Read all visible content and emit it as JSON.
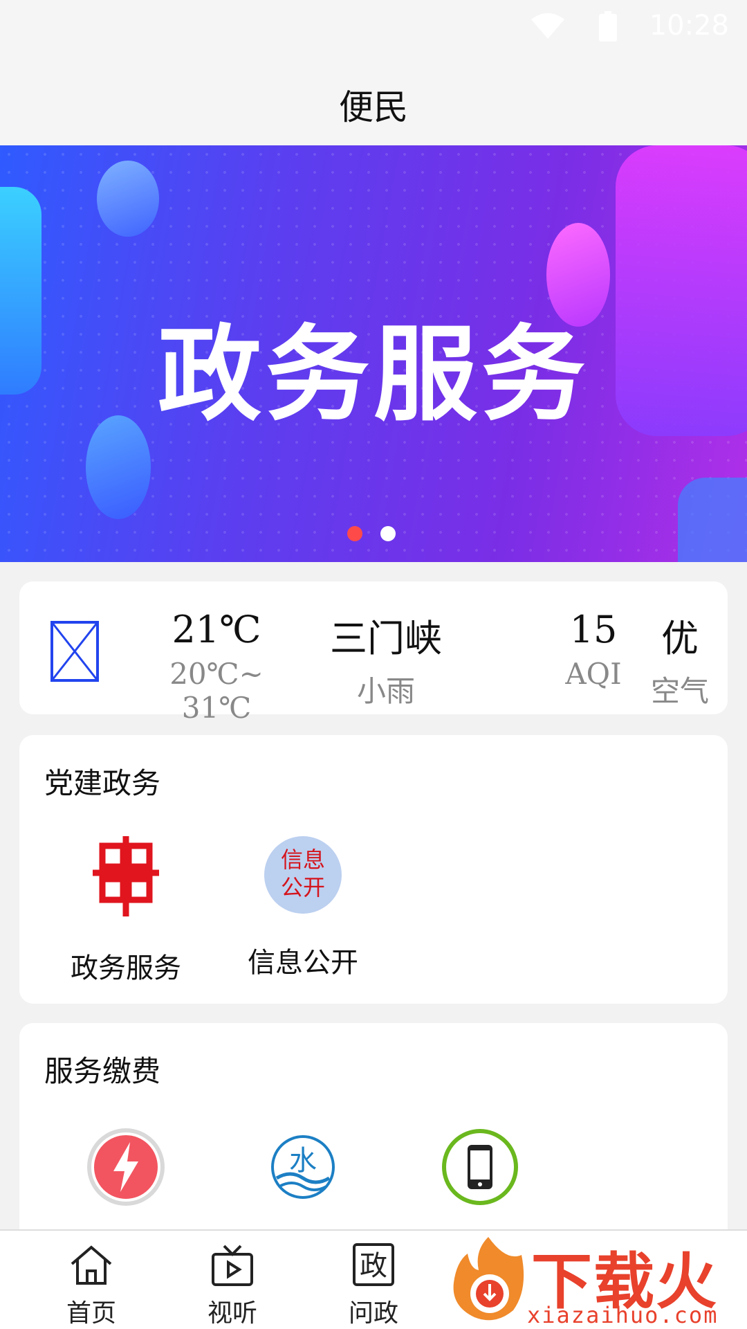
{
  "status_bar": {
    "time": "10:28"
  },
  "header": {
    "title": "便民"
  },
  "banner": {
    "headline": "政务服务",
    "slides": 2,
    "active_slide": 1
  },
  "weather": {
    "temperature": "21℃",
    "range": "20℃~ 31℃",
    "city": "三门峡",
    "condition": "小雨",
    "aqi_value": "15",
    "aqi_label": "AQI",
    "air_quality": "优",
    "air_label": "空气"
  },
  "sections": [
    {
      "title": "党建政务",
      "items": [
        {
          "label": "政务服务",
          "icon": "government-service-icon"
        },
        {
          "label": "信息公开",
          "icon": "info-disclosure-icon",
          "icon_text_top": "信息",
          "icon_text_bottom": "公开"
        }
      ]
    },
    {
      "title": "服务缴费",
      "items": [
        {
          "label": "",
          "icon": "electricity-icon"
        },
        {
          "label": "",
          "icon": "water-icon",
          "icon_text": "水"
        },
        {
          "label": "",
          "icon": "mobile-phone-icon"
        }
      ]
    }
  ],
  "bottom_nav": [
    {
      "label": "首页",
      "icon": "home-icon"
    },
    {
      "label": "视听",
      "icon": "tv-icon"
    },
    {
      "label": "问政",
      "icon": "politics-icon",
      "icon_text": "政"
    }
  ],
  "watermark": {
    "brand": "下载火",
    "url": "xiazaihuo.com"
  },
  "colors": {
    "accent_red": "#e8412c",
    "banner_start": "#2f5bff",
    "banner_end": "#b12fe8",
    "active_dot": "#ff4a4a"
  }
}
